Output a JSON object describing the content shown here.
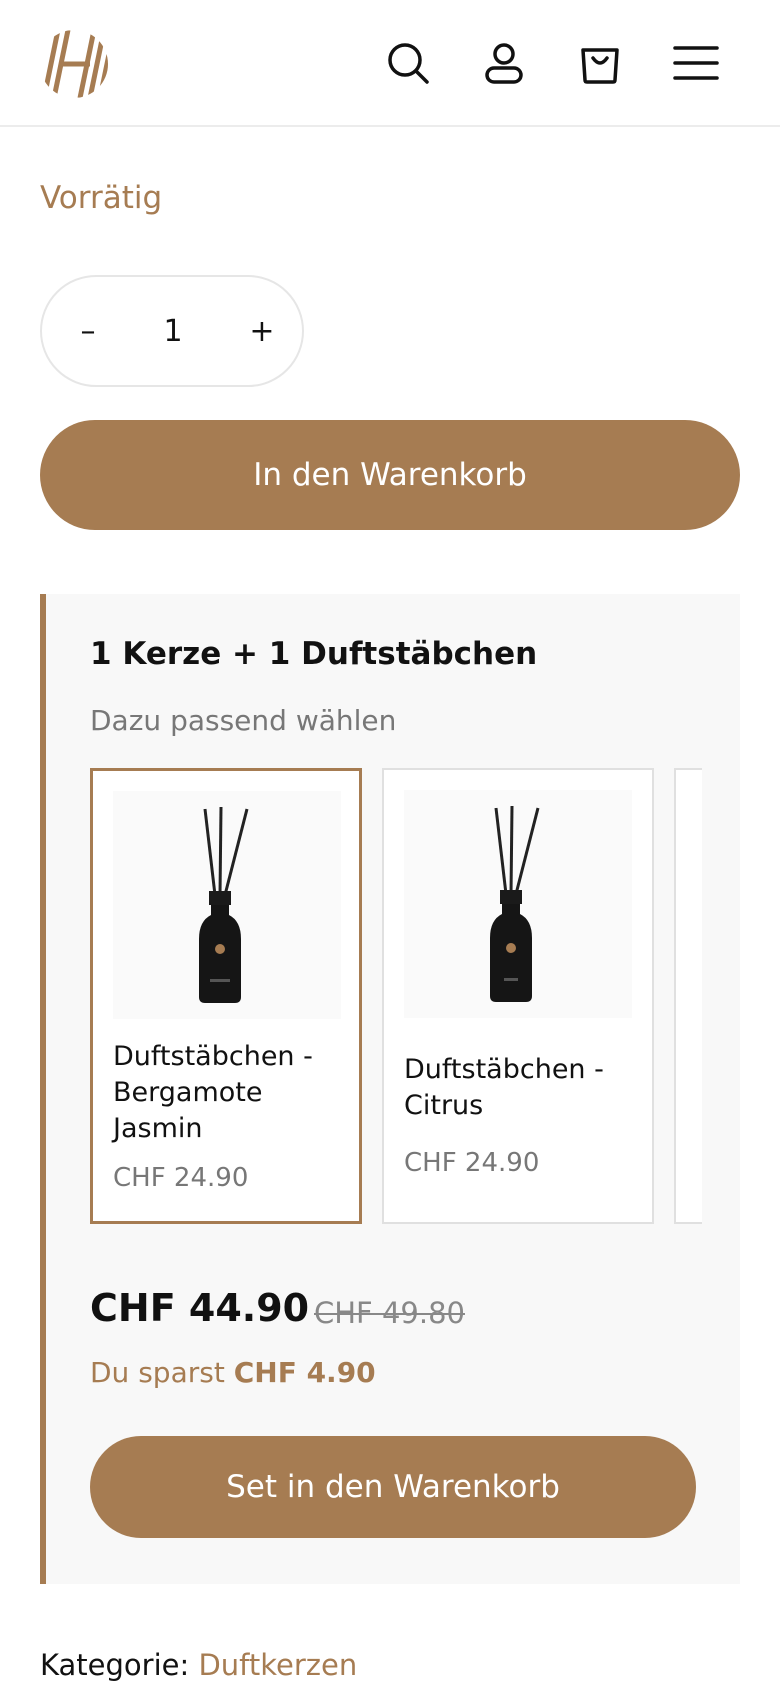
{
  "colors": {
    "accent": "#a67c52",
    "panel_bg": "#f8f8f8",
    "muted_text": "#777777"
  },
  "header": {
    "logo_icon": "brand-logo-icon",
    "icons": [
      "search-icon",
      "account-icon",
      "shopping-bag-icon",
      "hamburger-menu-icon"
    ]
  },
  "product": {
    "stock_status": "Vorrätig",
    "quantity": {
      "minus": "–",
      "value": "1",
      "plus": "+"
    },
    "add_to_cart_label": "In den Warenkorb"
  },
  "bundle": {
    "title": "1 Kerze + 1 Duftstäbchen",
    "subtitle": "Dazu passend wählen",
    "options": [
      {
        "name": "Duftstäbchen - Bergamote Jasmin",
        "price": "CHF 24.90",
        "selected": true
      },
      {
        "name": "Duftstäbchen - Citrus",
        "price": "CHF 24.90",
        "selected": false
      }
    ],
    "total_price": "CHF 44.90",
    "original_price": "CHF 49.80",
    "savings_label": "Du sparst",
    "savings_amount": "CHF 4.90",
    "add_set_label": "Set in den Warenkorb"
  },
  "meta": {
    "category_label": "Kategorie:",
    "category_value": "Duftkerzen"
  }
}
